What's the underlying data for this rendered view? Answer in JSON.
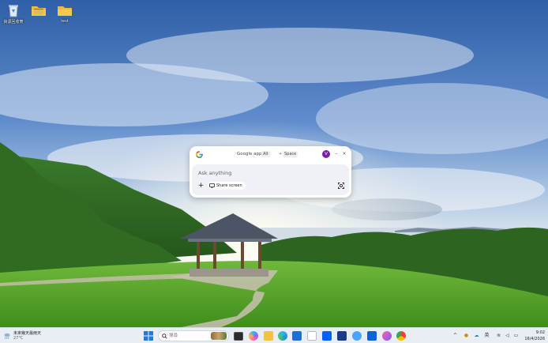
{
  "desktop": {
    "icons": [
      {
        "label": "資源回收筒",
        "icon": "recycle-bin-icon"
      },
      {
        "label": "",
        "icon": "folder-icon"
      },
      {
        "label": "test",
        "icon": "folder-icon"
      }
    ]
  },
  "google_app": {
    "title": "Google app",
    "shortcut_key1": "Alt",
    "shortcut_plus": "+",
    "shortcut_key2": "Space",
    "avatar_letter": "V",
    "minimize_label": "–",
    "close_label": "×",
    "input_placeholder": "Ask anything",
    "add_label": "+",
    "share_screen_label": "Share screen",
    "colors": {
      "avatar": "#7b1fa2",
      "body": "#eef1f5"
    }
  },
  "taskbar": {
    "weather_text": "未來幾天最雨天",
    "weather_temp": "27°C",
    "search_placeholder": "搜尋",
    "apps": [
      {
        "name": "task-view-icon"
      },
      {
        "name": "copilot-icon"
      },
      {
        "name": "file-explorer-icon"
      },
      {
        "name": "edge-icon"
      },
      {
        "name": "store-icon"
      },
      {
        "name": "outlook-icon"
      },
      {
        "name": "amazon-icon"
      },
      {
        "name": "dropbox-icon"
      },
      {
        "name": "app-b-icon"
      },
      {
        "name": "app-pencil-icon"
      },
      {
        "name": "app-blue-icon"
      },
      {
        "name": "app-pink-icon"
      },
      {
        "name": "chrome-icon"
      }
    ],
    "tray_language": "英",
    "time": "9:02",
    "date": "16/4/2026"
  }
}
